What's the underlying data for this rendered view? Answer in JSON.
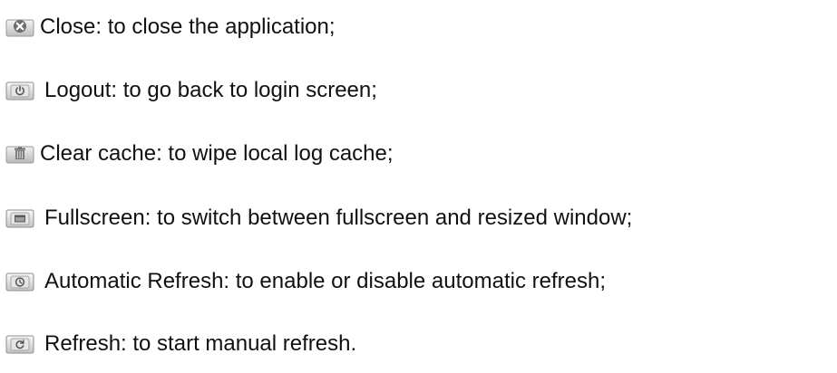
{
  "items": [
    {
      "icon": "close-icon",
      "label": "Close: to close the application;"
    },
    {
      "icon": "power-icon",
      "label": "Logout: to go back to login screen;"
    },
    {
      "icon": "trash-icon",
      "label": "Clear cache: to wipe local log cache;"
    },
    {
      "icon": "window-icon",
      "label": "Fullscreen: to switch between fullscreen and resized window;"
    },
    {
      "icon": "clock-icon",
      "label": "Automatic Refresh: to enable or disable automatic refresh;"
    },
    {
      "icon": "refresh-icon",
      "label": "Refresh: to start manual refresh."
    }
  ]
}
